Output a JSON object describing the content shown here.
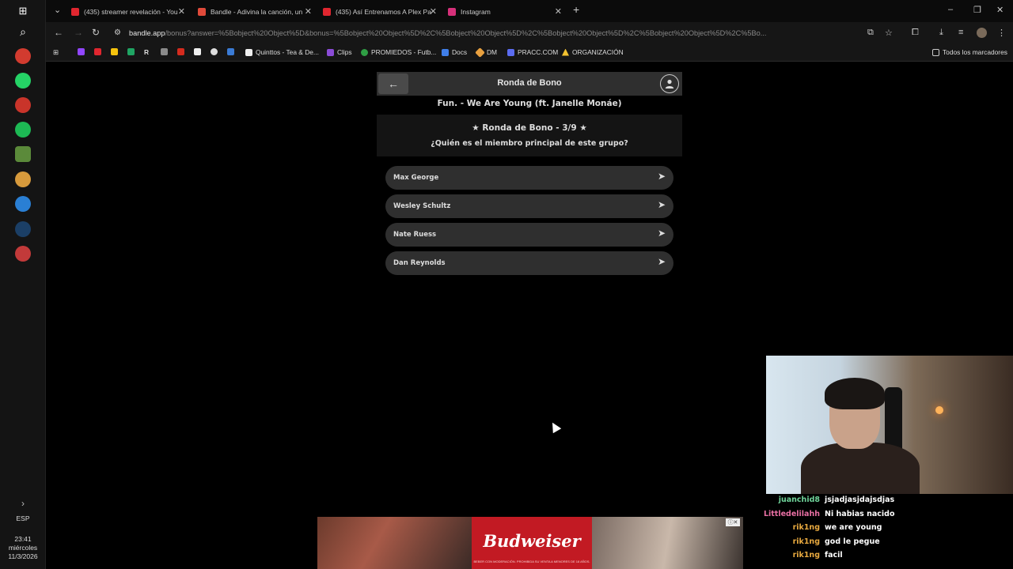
{
  "taskbar": {
    "lang": "ESP",
    "time": "23:41",
    "day": "miércoles",
    "date": "11/3/2026"
  },
  "browser": {
    "tabs": [
      {
        "label": "(435) streamer revelación - You",
        "color": "#e0262f"
      },
      {
        "label": "Bandle - Adivina la canción, un",
        "color": "#e04a3a"
      },
      {
        "label": "(435) Así Entrenamos A Plex Pa",
        "color": "#e0262f"
      },
      {
        "label": "Instagram",
        "color": "#d6307a"
      }
    ],
    "url_host": "bandle.app",
    "url_rest": "/bonus?answer=%5Bobject%20Object%5D&bonus=%5Bobject%20Object%5D%2C%5Bobject%20Object%5D%2C%5Bobject%20Object%5D%2C%5Bobject%20Object%5D%2C%5Bo...",
    "bookmarks": [
      {
        "label": "Quinttos - Tea & De...",
        "color": "#eeeeee"
      },
      {
        "label": "Clips",
        "color": "#8a4bd6"
      },
      {
        "label": "PROMIEDOS - Futb...",
        "color": "#2f9e44"
      },
      {
        "label": "Docs",
        "color": "#3f7ee8"
      },
      {
        "label": "DM",
        "color": "#e8a03f"
      },
      {
        "label": "PRACC.COM",
        "color": "#5b6cf0"
      },
      {
        "label": "ORGANIZACIÓN",
        "color": "#f2c230"
      }
    ],
    "all_bookmarks": "Todos los marcadores"
  },
  "app": {
    "header_title": "Ronda de Bono",
    "song": "Fun. - We Are Young (ft. Janelle Monáe)",
    "bonus_round": "★ Ronda de Bono - 3/9 ★",
    "question": "¿Quién es el miembro principal de este grupo?",
    "options": [
      "Max George",
      "Wesley Schultz",
      "Nate Ruess",
      "Dan Reynolds"
    ]
  },
  "ad": {
    "brand": "Budweiser",
    "fine_print": "BEBER CON MODERACIÓN. PROHIBIDA SU VENTA A MENORES DE 18 AÑOS."
  },
  "chat": [
    {
      "user": "juanchid8",
      "msg": "jsjadjasjdajsdjas",
      "color": "#6fd39a"
    },
    {
      "user": "Littledelilahh",
      "msg": "Ni habias nacido",
      "color": "#e86fa3"
    },
    {
      "user": "rik1ng",
      "msg": "we are young",
      "color": "#e8a93f"
    },
    {
      "user": "rik1ng",
      "msg": "god le pegue",
      "color": "#e8a93f"
    },
    {
      "user": "rik1ng",
      "msg": "facil",
      "color": "#e8a93f"
    }
  ]
}
